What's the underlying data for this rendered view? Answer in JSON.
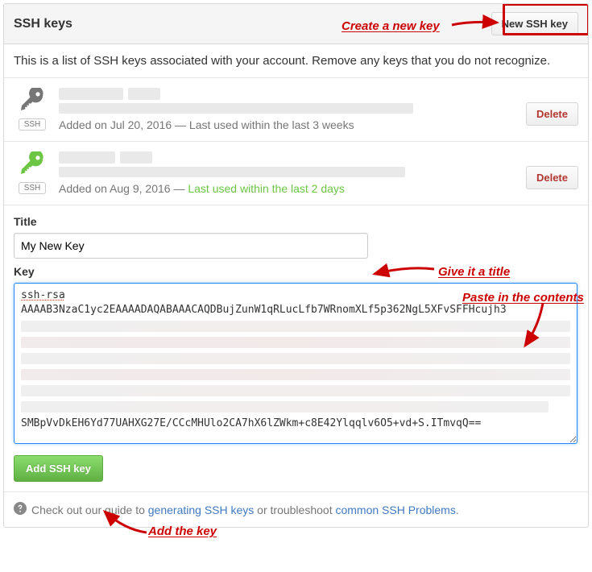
{
  "header": {
    "title": "SSH keys",
    "new_button": "New SSH key"
  },
  "description": "This is a list of SSH keys associated with your account. Remove any keys that you do not recognize.",
  "keys": [
    {
      "badge": "SSH",
      "added": "Added on Jul 20, 2016",
      "sep": " — ",
      "used": "Last used within the last 3 weeks",
      "green": false,
      "delete": "Delete"
    },
    {
      "badge": "SSH",
      "added": "Added on Aug 9, 2016",
      "sep": " — ",
      "used": "Last used within the last 2 days",
      "green": true,
      "delete": "Delete"
    }
  ],
  "form": {
    "title_label": "Title",
    "title_value": "My New Key",
    "key_label": "Key",
    "key_line1": "ssh-rsa",
    "key_line2": "AAAAB3NzaC1yc2EAAAADAQABAAACAQDBujZunW1qRLucLfb7WRnomXLf5p362NgL5XFvSFFHcujh3",
    "key_last": "SMBpVvDkEH6Yd77UAHXG27E/CCcMHUlo2CA7hX6lZWkm+c8E42Ylqqlv6O5+vd+S.ITmvqQ==",
    "add_button": "Add SSH key"
  },
  "footer": {
    "prefix": "Check out our guide to ",
    "link1": "generating SSH keys",
    "mid": " or troubleshoot ",
    "link2": "common SSH Problems",
    "suffix": "."
  },
  "annotations": {
    "create": "Create a new key",
    "title": "Give it a title",
    "paste": "Paste in the contents",
    "add": "Add the key"
  }
}
